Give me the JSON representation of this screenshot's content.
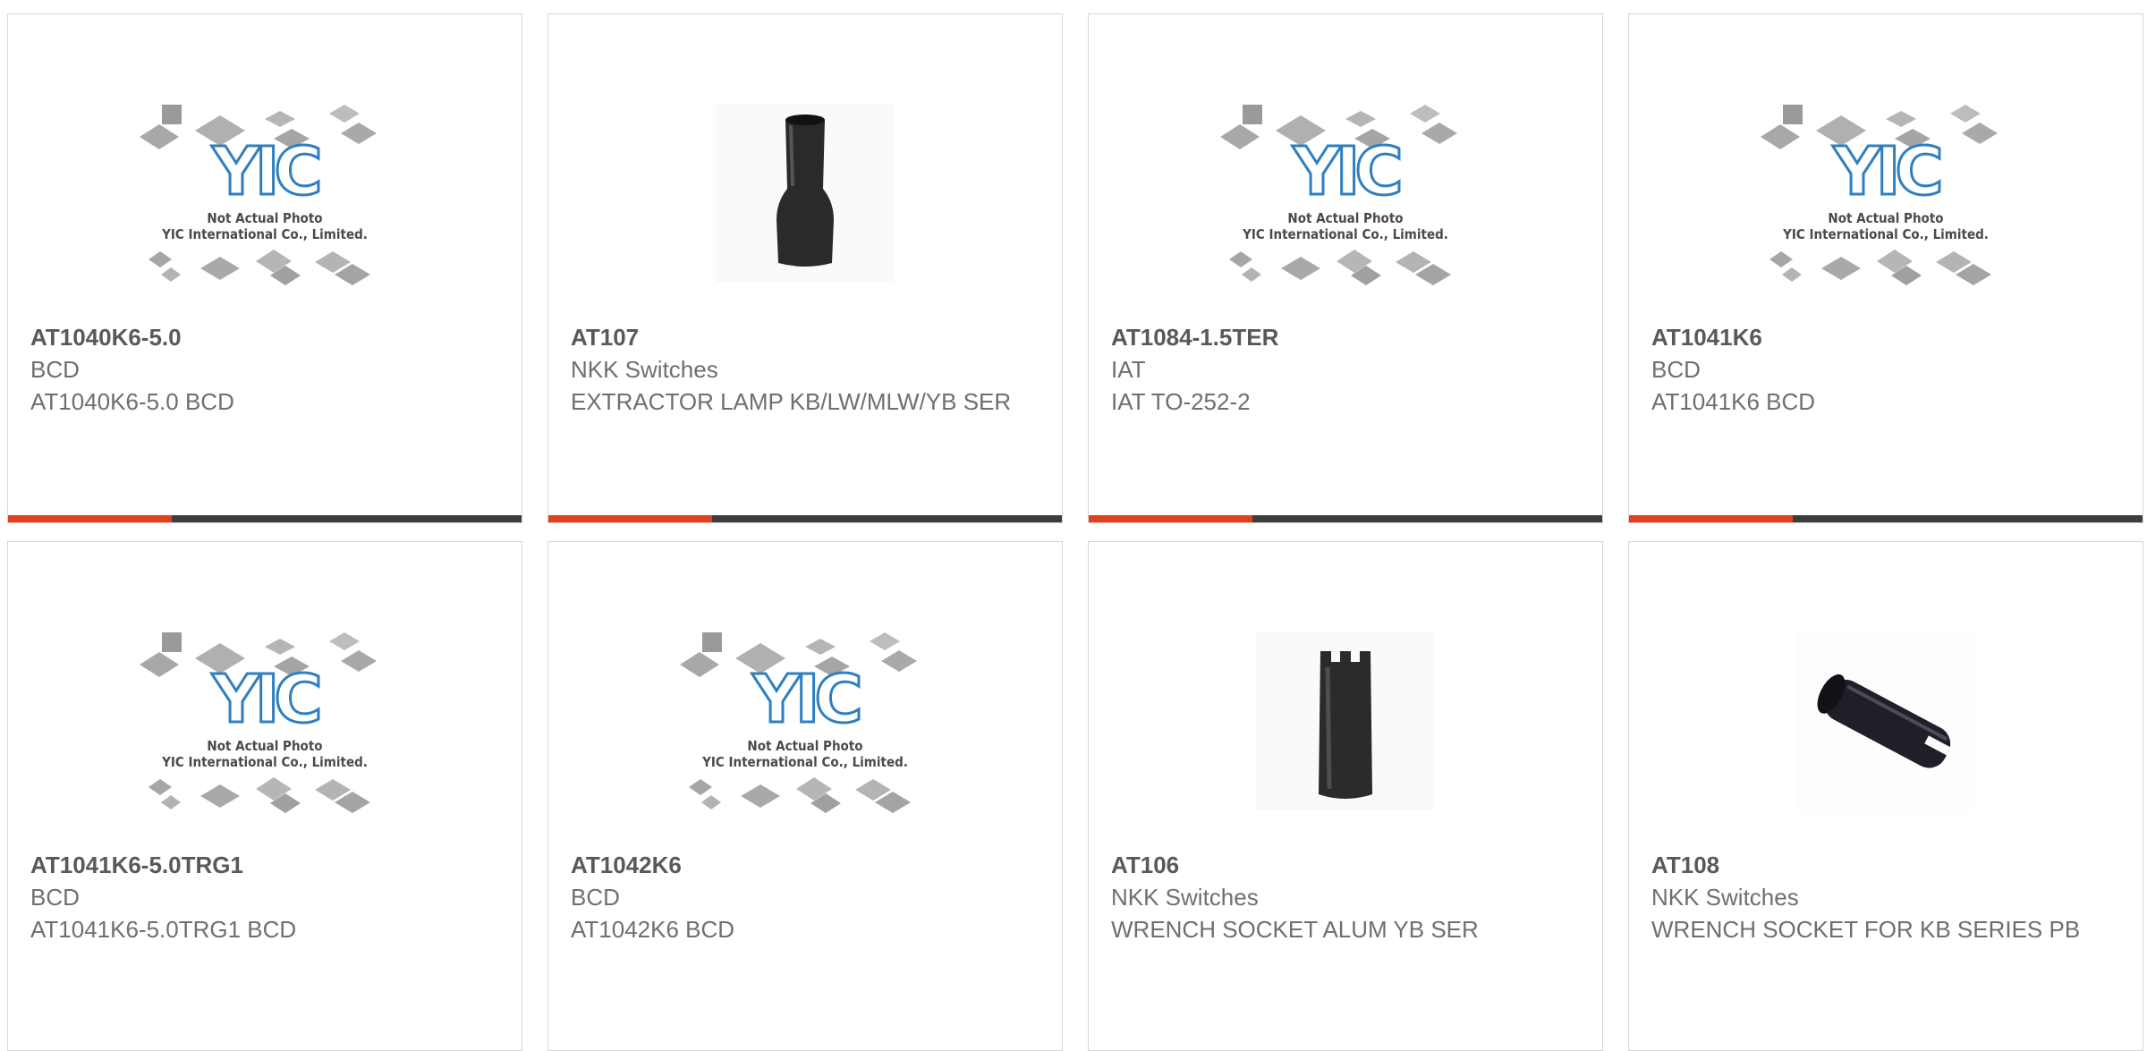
{
  "placeholder": {
    "caption_line1": "Not Actual Photo",
    "caption_line2": "YIC International Co., Limited.",
    "logo_text": "YIC"
  },
  "colors": {
    "accent": "#e0401c",
    "bar": "#3d3d3d",
    "border": "#d6d6d6",
    "logo_blue": "#2f7fc0"
  },
  "products": [
    {
      "part": "AT1040K6-5.0",
      "manufacturer": "BCD",
      "description": "AT1040K6-5.0 BCD",
      "image": "placeholder-logo"
    },
    {
      "part": "AT107",
      "manufacturer": "NKK Switches",
      "description": "EXTRACTOR LAMP KB/LW/MLW/YB SER",
      "image": "extractor-tool"
    },
    {
      "part": "AT1084-1.5TER",
      "manufacturer": "IAT",
      "description": "IAT TO-252-2",
      "image": "placeholder-logo"
    },
    {
      "part": "AT1041K6",
      "manufacturer": "BCD",
      "description": "AT1041K6 BCD",
      "image": "placeholder-logo"
    },
    {
      "part": "AT1041K6-5.0TRG1",
      "manufacturer": "BCD",
      "description": "AT1041K6-5.0TRG1 BCD",
      "image": "placeholder-logo"
    },
    {
      "part": "AT1042K6",
      "manufacturer": "BCD",
      "description": "AT1042K6 BCD",
      "image": "placeholder-logo"
    },
    {
      "part": "AT106",
      "manufacturer": "NKK Switches",
      "description": "WRENCH SOCKET ALUM YB SER",
      "image": "wrench-socket-upright"
    },
    {
      "part": "AT108",
      "manufacturer": "NKK Switches",
      "description": "WRENCH SOCKET FOR KB SERIES PB",
      "image": "wrench-socket-tilted"
    }
  ]
}
